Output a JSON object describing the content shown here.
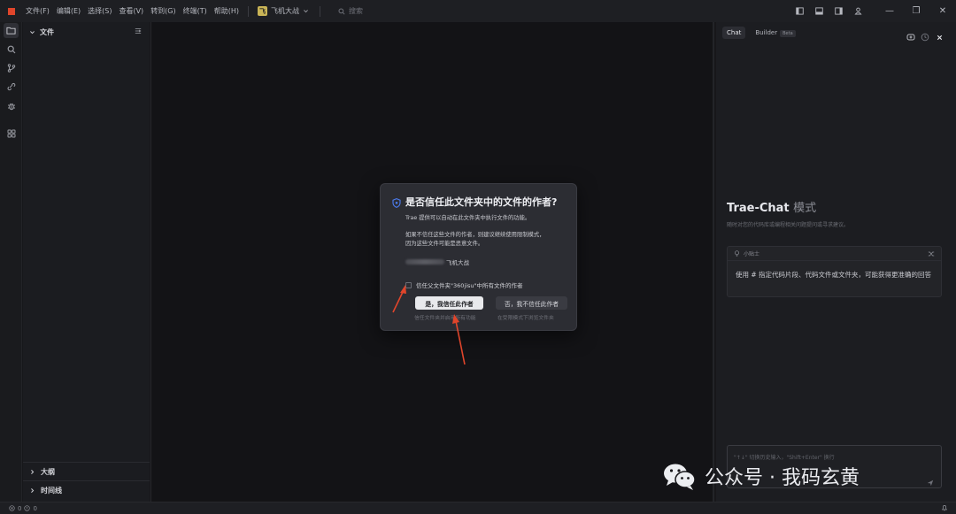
{
  "titlebar": {
    "menu": [
      "文件(F)",
      "编辑(E)",
      "选择(S)",
      "查看(V)",
      "转到(G)",
      "终端(T)",
      "帮助(H)"
    ],
    "project_badge": "飞",
    "project_name": "飞机大战",
    "search_placeholder": "搜索"
  },
  "sidebar": {
    "files_header": "文件",
    "outline": "大纲",
    "timeline": "时间线"
  },
  "chat": {
    "tab_chat": "Chat",
    "tab_builder": "Builder",
    "beta": "Beta",
    "title": "Trae-Chat",
    "mode": "模式",
    "subtitle": "随时对您的代码库或编程相关问题提问或寻求建议。",
    "tip_label": "小贴士",
    "tip_text": "使用 # 指定代码片段、代码文件或文件夹，可能获得更准确的回答",
    "input_placeholder": "\"↑↓\" 切换历史输入，\"Shift+Enter\" 换行"
  },
  "dialog": {
    "title": "是否信任此文件夹中的文件的作者?",
    "line1": "Trae 提供可以自动在此文件夹中执行文件的功能。",
    "line2": "如果不信任这些文件的作者，则建议继续使用限制模式，",
    "line3": "因为这些文件可能是恶意文件。",
    "path_suffix": "飞机大战",
    "checkbox_label": "信任父文件夹\"360jisu\"中所有文件的作者",
    "yes_button": "是，我信任此作者",
    "no_button": "否，我不信任此作者",
    "yes_sub": "信任文件夹并启用所有功能",
    "no_sub": "在受限模式下浏览文件夹"
  },
  "statusbar": {
    "errors": "0",
    "warnings": "0"
  },
  "watermark": "公众号 · 我码玄黄",
  "colors": {
    "accent_shield": "#4c7cf0",
    "arrow": "#e0452b",
    "logo": "#e0452b"
  }
}
